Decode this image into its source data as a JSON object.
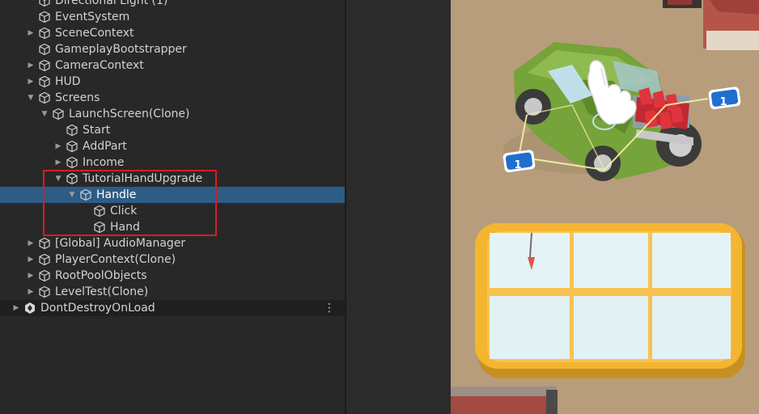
{
  "hierarchy": {
    "rows": [
      {
        "label": "Directional Light (1)",
        "depth": 0,
        "arrow": "",
        "icon": "cube"
      },
      {
        "label": "EventSystem",
        "depth": 0,
        "arrow": "",
        "icon": "cube"
      },
      {
        "label": "SceneContext",
        "depth": 0,
        "arrow": "right",
        "icon": "cube"
      },
      {
        "label": "GameplayBootstrapper",
        "depth": 0,
        "arrow": "",
        "icon": "cube"
      },
      {
        "label": "CameraContext",
        "depth": 0,
        "arrow": "right",
        "icon": "cube"
      },
      {
        "label": "HUD",
        "depth": 0,
        "arrow": "right",
        "icon": "cube"
      },
      {
        "label": "Screens",
        "depth": 0,
        "arrow": "down",
        "icon": "cube"
      },
      {
        "label": "LaunchScreen(Clone)",
        "depth": 1,
        "arrow": "down",
        "icon": "cube"
      },
      {
        "label": "Start",
        "depth": 2,
        "arrow": "",
        "icon": "cube"
      },
      {
        "label": "AddPart",
        "depth": 2,
        "arrow": "right",
        "icon": "cube"
      },
      {
        "label": "Income",
        "depth": 2,
        "arrow": "right",
        "icon": "cube"
      },
      {
        "label": "TutorialHandUpgrade",
        "depth": 2,
        "arrow": "down",
        "icon": "cube"
      },
      {
        "label": "Handle",
        "depth": 3,
        "arrow": "down",
        "icon": "cube",
        "selected": true
      },
      {
        "label": "Click",
        "depth": 4,
        "arrow": "",
        "icon": "cube"
      },
      {
        "label": "Hand",
        "depth": 4,
        "arrow": "",
        "icon": "cube"
      },
      {
        "label": "[Global] AudioManager",
        "depth": 0,
        "arrow": "right",
        "icon": "cube"
      },
      {
        "label": "PlayerContext(Clone)",
        "depth": 0,
        "arrow": "right",
        "icon": "cube"
      },
      {
        "label": "RootPoolObjects",
        "depth": 0,
        "arrow": "right",
        "icon": "cube"
      },
      {
        "label": "LevelTest(Clone)",
        "depth": 0,
        "arrow": "right",
        "icon": "cube"
      },
      {
        "label": "DontDestroyOnLoad",
        "depth": -1,
        "arrow": "right",
        "icon": "unity-scene",
        "scene": true
      }
    ]
  },
  "game": {
    "badge_left": "1",
    "badge_right": "1"
  },
  "colors": {
    "selection": "#2c5d87",
    "highlight": "#d41e27",
    "ground": "#b79d7c",
    "jeep": "#76a33a",
    "tray": "#f4b531"
  }
}
